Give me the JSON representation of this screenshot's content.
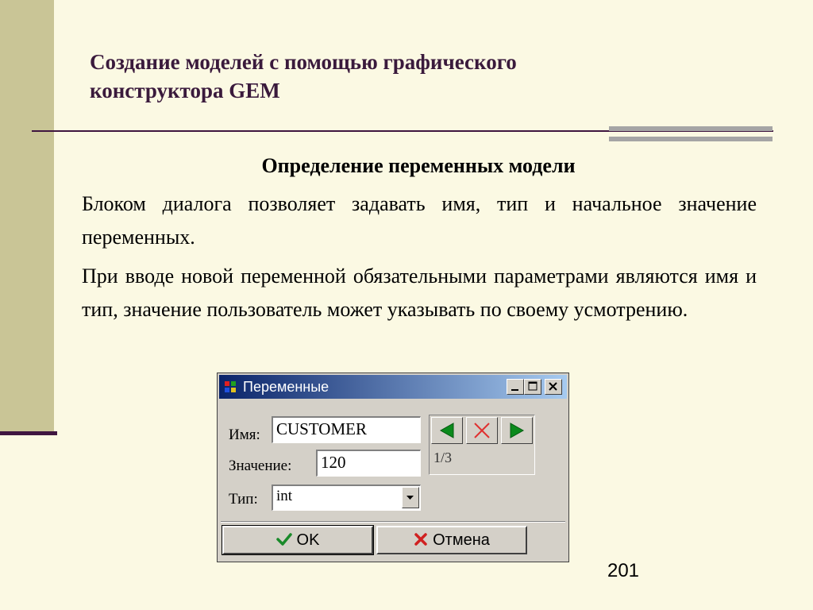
{
  "slide": {
    "title_line1": "Создание моделей с помощью графического",
    "title_line2": "конструктора GEM",
    "subtitle": "Определение переменных модели",
    "paragraph1": "Блоком диалога позволяет задавать имя, тип и начальное значение переменных.",
    "paragraph2": "При вводе новой переменной обязательными параметрами являются имя и тип, значение пользователь может указывать по своему усмотрению.",
    "page_number": "201",
    "colors": {
      "accent": "#3f1640",
      "band": "#c9c596",
      "background": "#fbf9e3"
    }
  },
  "dialog": {
    "title": "Переменные",
    "labels": {
      "name": "Имя:",
      "value": "Значение:",
      "type": "Тип:"
    },
    "name_value": "CUSTOMER",
    "value_value": "120",
    "type_selected": "int",
    "counter": "1/3",
    "ok_label": "OK",
    "cancel_label": "Отмена",
    "icons": [
      "minimize-icon",
      "maximize-icon",
      "close-icon",
      "arrow-left-icon",
      "delete-icon",
      "arrow-right-icon",
      "checkmark-icon",
      "cross-icon",
      "chevron-down-icon"
    ]
  }
}
